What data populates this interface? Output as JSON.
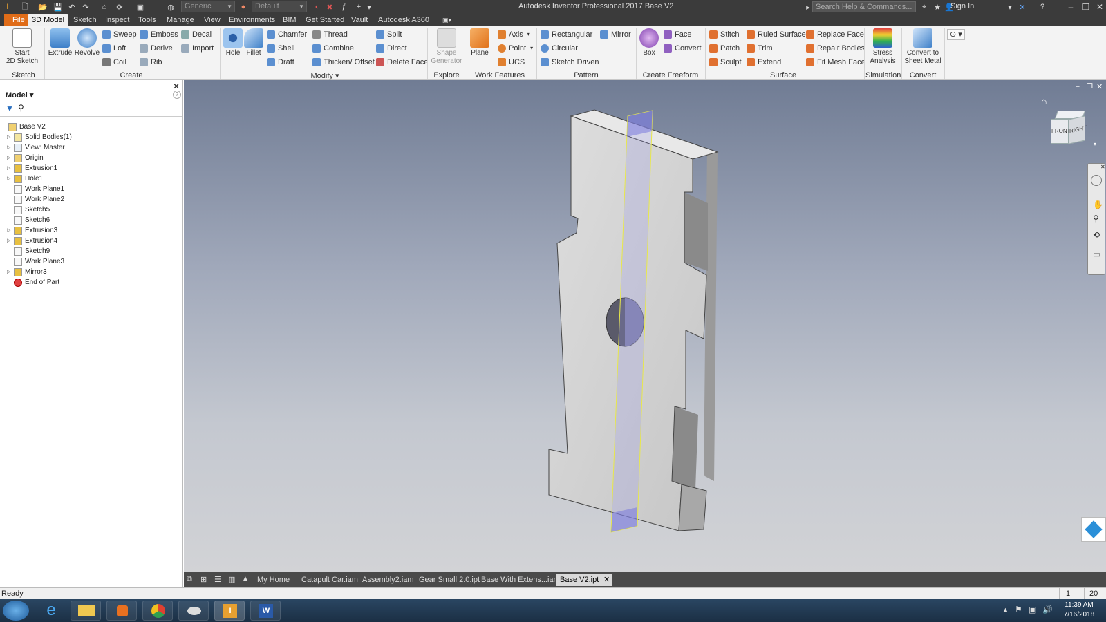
{
  "titlebar": {
    "app_title": "Autodesk Inventor Professional 2017   Base V2",
    "material_combo": "Generic",
    "appearance_combo": "Default",
    "search_placeholder": "Search Help & Commands...",
    "sign_in": "Sign In"
  },
  "tabs": [
    {
      "label": "File"
    },
    {
      "label": "3D Model"
    },
    {
      "label": "Sketch"
    },
    {
      "label": "Inspect"
    },
    {
      "label": "Tools"
    },
    {
      "label": "Manage"
    },
    {
      "label": "View"
    },
    {
      "label": "Environments"
    },
    {
      "label": "BIM"
    },
    {
      "label": "Get Started"
    },
    {
      "label": "Vault"
    },
    {
      "label": "Autodesk A360"
    }
  ],
  "ribbon": {
    "sketch": {
      "panel": "Sketch",
      "start_line1": "Start",
      "start_line2": "2D Sketch"
    },
    "create": {
      "panel": "Create",
      "extrude": "Extrude",
      "revolve": "Revolve",
      "sweep": "Sweep",
      "emboss": "Emboss",
      "decal": "Decal",
      "loft": "Loft",
      "derive": "Derive",
      "import": "Import",
      "coil": "Coil",
      "rib": "Rib"
    },
    "modify": {
      "panel": "Modify",
      "hole": "Hole",
      "fillet": "Fillet",
      "chamfer": "Chamfer",
      "thread": "Thread",
      "split": "Split",
      "shell": "Shell",
      "combine": "Combine",
      "direct": "Direct",
      "draft": "Draft",
      "thicken": "Thicken/ Offset",
      "delete_face": "Delete Face"
    },
    "explore": {
      "panel": "Explore",
      "shape_line1": "Shape",
      "shape_line2": "Generator"
    },
    "work": {
      "panel": "Work Features",
      "plane": "Plane",
      "axis": "Axis",
      "point": "Point",
      "ucs": "UCS"
    },
    "pattern": {
      "panel": "Pattern",
      "rectangular": "Rectangular",
      "mirror": "Mirror",
      "circular": "Circular",
      "sketch_driven": "Sketch Driven"
    },
    "freeform": {
      "panel": "Create Freeform",
      "box": "Box",
      "face": "Face",
      "convert": "Convert"
    },
    "surface": {
      "panel": "Surface",
      "stitch": "Stitch",
      "ruled": "Ruled Surface",
      "replace": "Replace Face",
      "patch": "Patch",
      "trim": "Trim",
      "repair": "Repair Bodies",
      "sculpt": "Sculpt",
      "extend": "Extend",
      "fit_mesh": "Fit Mesh Face"
    },
    "simulation": {
      "panel": "Simulation",
      "stress_line1": "Stress",
      "stress_line2": "Analysis"
    },
    "convert": {
      "panel": "Convert",
      "sheet_line1": "Convert to",
      "sheet_line2": "Sheet Metal"
    }
  },
  "browser": {
    "title": "Model",
    "items": [
      {
        "label": "Base V2",
        "expand": ""
      },
      {
        "label": "Solid Bodies(1)",
        "expand": "▷"
      },
      {
        "label": "View: Master",
        "expand": "▷"
      },
      {
        "label": "Origin",
        "expand": "▷"
      },
      {
        "label": "Extrusion1",
        "expand": "▷"
      },
      {
        "label": "Hole1",
        "expand": "▷"
      },
      {
        "label": "Work Plane1",
        "expand": ""
      },
      {
        "label": "Work Plane2",
        "expand": ""
      },
      {
        "label": "Sketch5",
        "expand": ""
      },
      {
        "label": "Sketch6",
        "expand": ""
      },
      {
        "label": "Extrusion3",
        "expand": "▷"
      },
      {
        "label": "Extrusion4",
        "expand": "▷"
      },
      {
        "label": "Sketch9",
        "expand": ""
      },
      {
        "label": "Work Plane3",
        "expand": ""
      },
      {
        "label": "Mirror3",
        "expand": "▷"
      },
      {
        "label": "End of Part",
        "expand": ""
      }
    ]
  },
  "viewcube": {
    "front": "FRONT",
    "right": "RIGHT"
  },
  "doctabs": [
    "My Home",
    "Catapult Car.iam",
    "Assembly2.iam",
    "Gear Small 2.0.ipt",
    "Base With Extens...iam",
    "Base V2.ipt"
  ],
  "status": {
    "text": "Ready",
    "count1": "1",
    "count2": "20"
  },
  "clock": {
    "time": "11:39 AM",
    "date": "7/16/2018"
  }
}
